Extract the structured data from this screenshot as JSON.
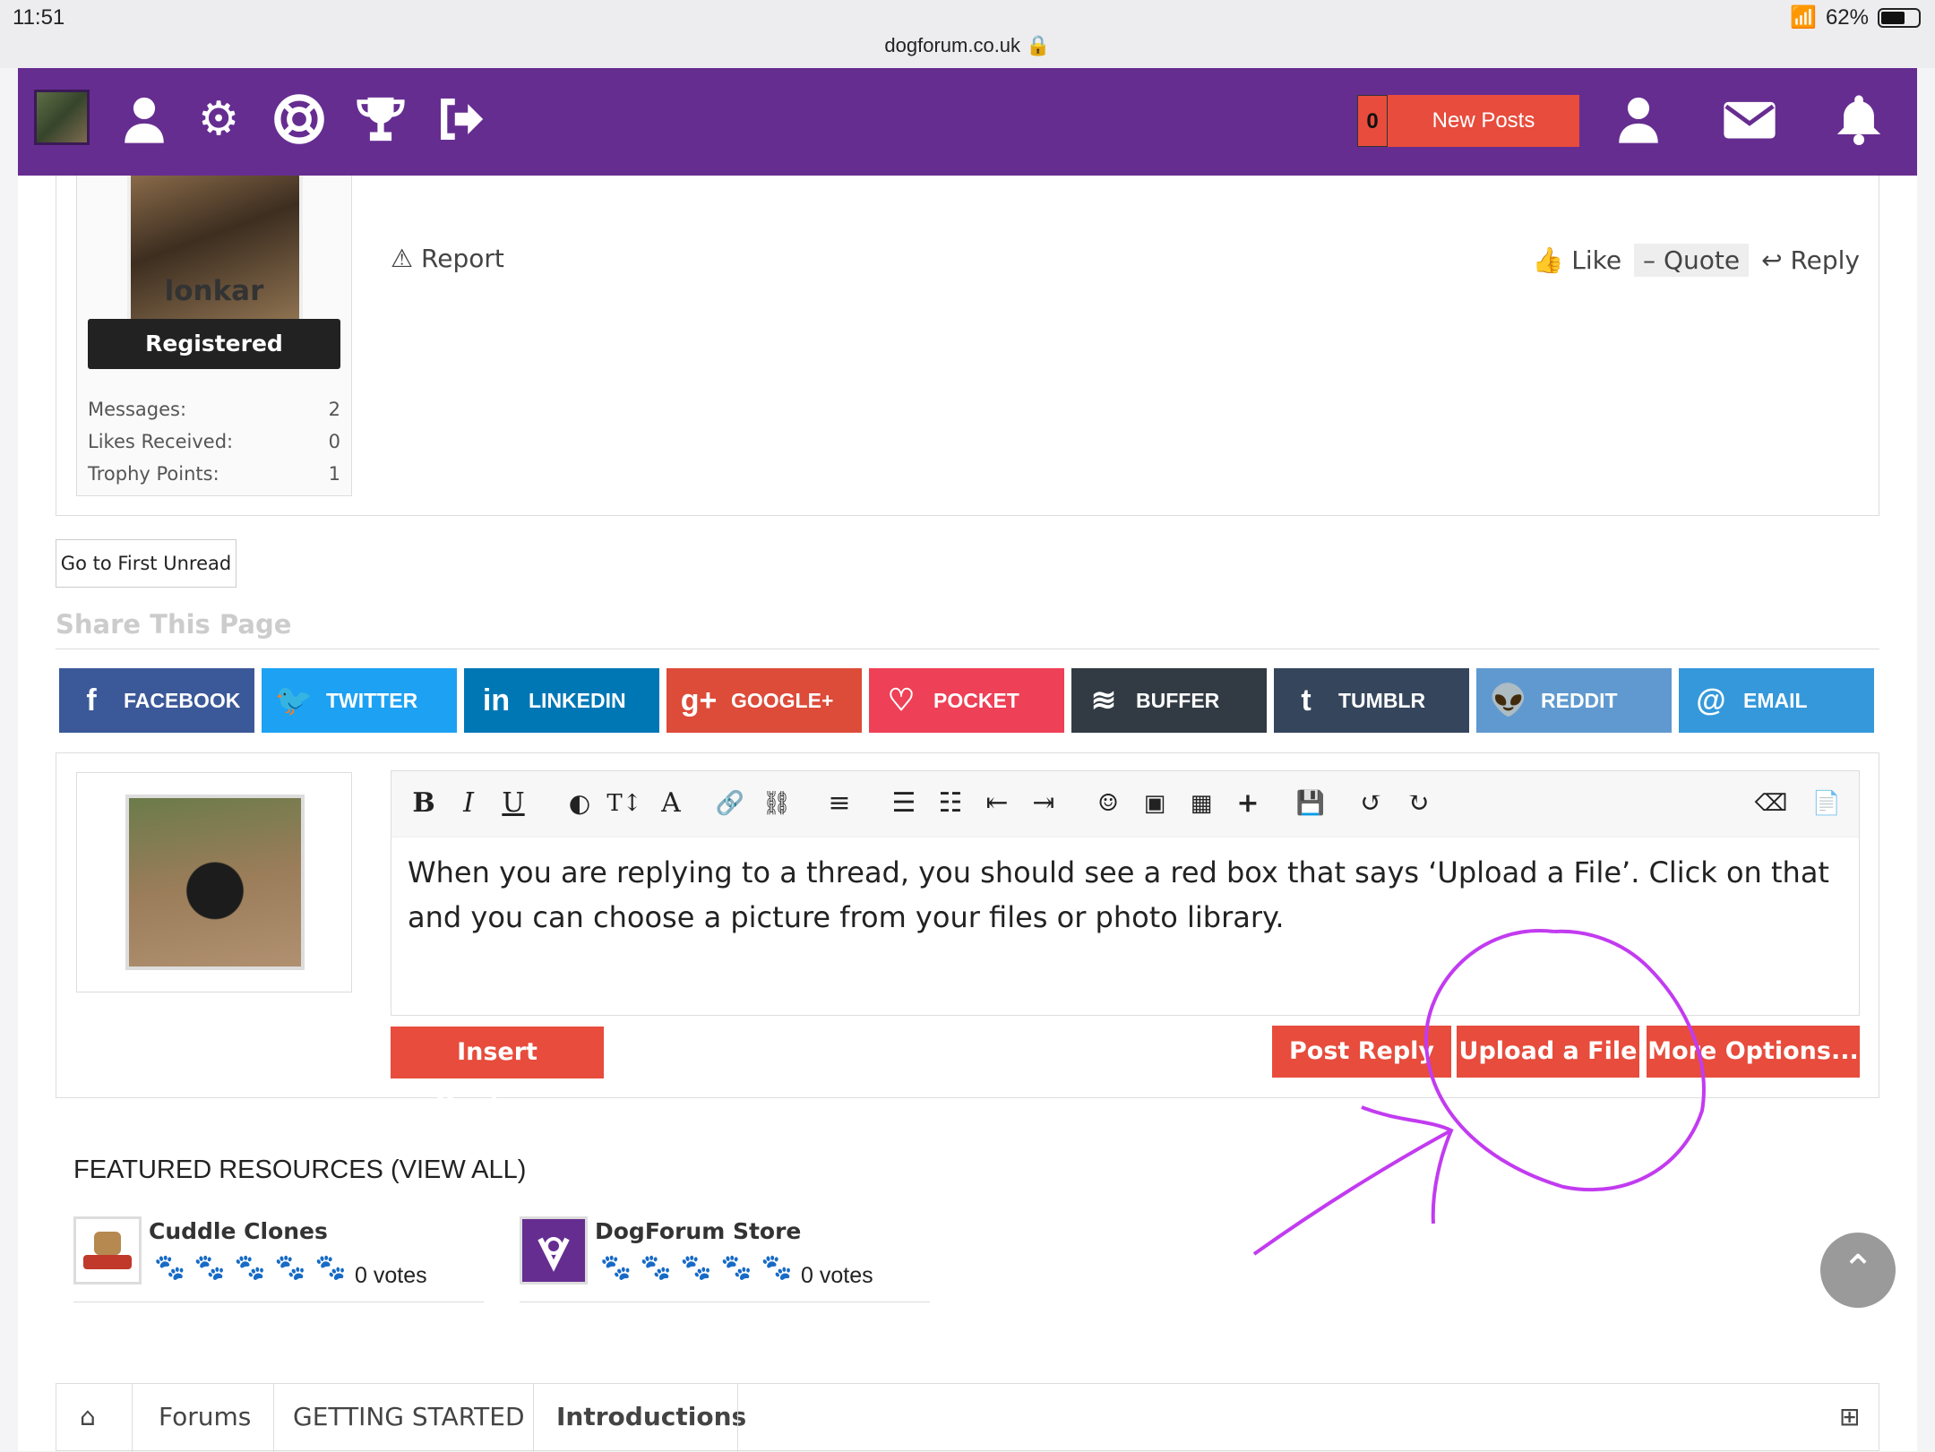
{
  "statusbar": {
    "time": "11:51",
    "url": "dogforum.co.uk",
    "battery": "62%",
    "battery_level": 0.62
  },
  "nav": {
    "new_posts_count": "0",
    "new_posts_label": "New Posts",
    "icons": [
      "user-icon",
      "gear-icon",
      "lifebuoy-icon",
      "trophy-icon",
      "logout-icon",
      "account-icon",
      "mail-icon",
      "bell-icon"
    ]
  },
  "post": {
    "username": "lonkar",
    "role": "Registered",
    "stats": [
      {
        "label": "Messages:",
        "value": "2"
      },
      {
        "label": "Likes Received:",
        "value": "0"
      },
      {
        "label": "Trophy Points:",
        "value": "1"
      }
    ],
    "report": "Report",
    "like": "Like",
    "quote": "– Quote",
    "reply": "Reply"
  },
  "first_unread": "Go to First Unread",
  "share": {
    "title": "Share This Page",
    "buttons": [
      {
        "label": "FACEBOOK",
        "color": "#3b5998",
        "icon": "facebook-icon"
      },
      {
        "label": "TWITTER",
        "color": "#1da1f2",
        "icon": "twitter-icon"
      },
      {
        "label": "LINKEDIN",
        "color": "#0077b5",
        "icon": "linkedin-icon"
      },
      {
        "label": "GOOGLE+",
        "color": "#dd4b39",
        "icon": "googleplus-icon"
      },
      {
        "label": "POCKET",
        "color": "#ee4056",
        "icon": "pocket-icon"
      },
      {
        "label": "BUFFER",
        "color": "#323b43",
        "icon": "buffer-icon"
      },
      {
        "label": "TUMBLR",
        "color": "#35465c",
        "icon": "tumblr-icon"
      },
      {
        "label": "REDDIT",
        "color": "#5f99cf",
        "icon": "reddit-icon"
      },
      {
        "label": "EMAIL",
        "color": "#3498db",
        "icon": "email-icon"
      }
    ]
  },
  "editor": {
    "text": "When you are replying to a thread, you should see a red box that says ‘Upload a File’. Click on that and you can choose a picture from your files or photo library.",
    "insert_quotes": "Insert Quotes...",
    "post_reply": "Post Reply",
    "upload": "Upload a File",
    "more_options": "More Options..."
  },
  "featured": {
    "title": "FEATURED RESOURCES (VIEW ALL)",
    "items": [
      {
        "name": "Cuddle Clones",
        "votes": "0 votes"
      },
      {
        "name": "DogForum Store",
        "votes": "0 votes"
      }
    ]
  },
  "breadcrumbs": [
    "Forums",
    "GETTING STARTED",
    "Introductions"
  ],
  "colors": {
    "nav": "#662d91",
    "accent_red": "#e74c3c",
    "annotation": "#c23bf0"
  }
}
